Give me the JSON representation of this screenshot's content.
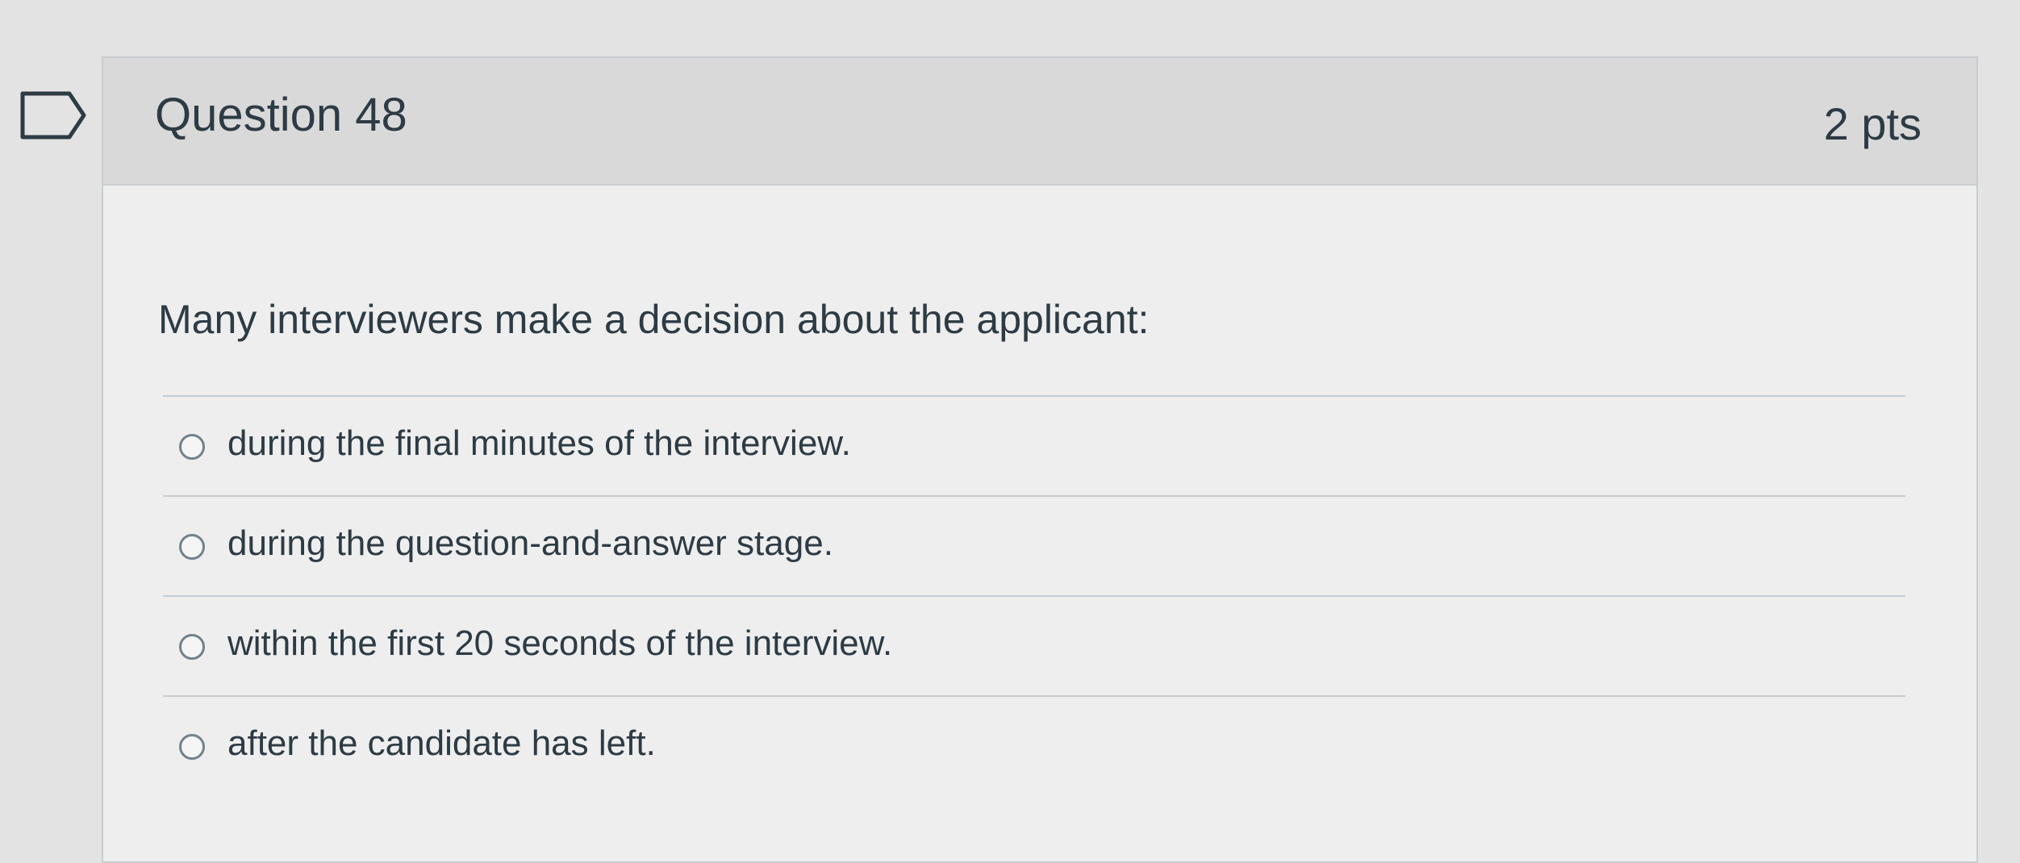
{
  "question": {
    "title": "Question 48",
    "points": "2 pts",
    "flag_icon": "bookmark-flag-icon",
    "text": "Many interviewers make a decision about the applicant:",
    "answers": [
      {
        "label": "during the final minutes of the interview.",
        "selected": false
      },
      {
        "label": "during the question-and-answer stage.",
        "selected": false
      },
      {
        "label": "within the first 20 seconds of the interview.",
        "selected": false
      },
      {
        "label": "after the candidate has left.",
        "selected": false
      }
    ]
  },
  "colors": {
    "text": "#2d3b45",
    "header_bg": "#d9d9d9",
    "card_bg": "#eeeeee",
    "border": "#c7cdd1"
  }
}
